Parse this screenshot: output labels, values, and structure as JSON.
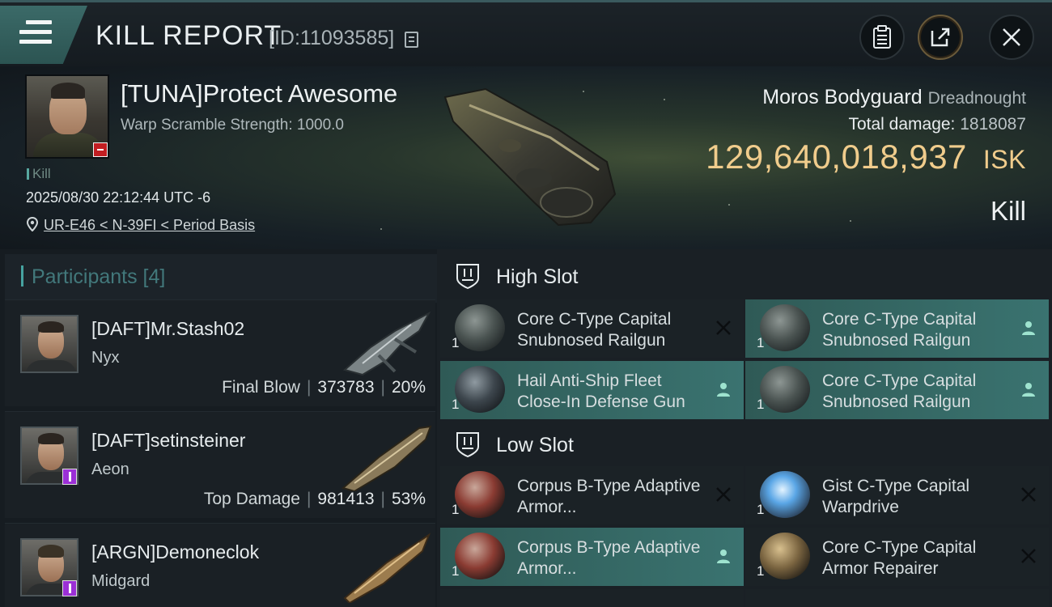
{
  "header": {
    "title": "KILL REPORT",
    "kill_id": "[ID:11093585]"
  },
  "victim": {
    "name": "[TUNA]Protect Awesome",
    "scramble": "Warp Scramble Strength: 1000.0",
    "tag": "Kill",
    "datetime": "2025/08/30 22:12:44 UTC -6",
    "location": "UR-E46 < N-39FI < Period Basis"
  },
  "ship": {
    "name": "Moros Bodyguard",
    "class": "Dreadnought",
    "damage_label": "Total damage:",
    "damage_value": "1818087",
    "isk_value": "129,640,018,937",
    "isk_unit": "ISK",
    "result": "Kill"
  },
  "participants": {
    "label": "Participants [4]",
    "items": [
      {
        "name": "[DAFT]Mr.Stash02",
        "ship": "Nyx",
        "role": "Final Blow",
        "damage": "373783",
        "percent": "20%"
      },
      {
        "name": "[DAFT]setinsteiner",
        "ship": "Aeon",
        "role": "Top Damage",
        "damage": "981413",
        "percent": "53%"
      },
      {
        "name": "[ARGN]Demoneclok",
        "ship": "Midgard",
        "role": "",
        "damage": "",
        "percent": ""
      }
    ]
  },
  "sections": {
    "high": "High Slot",
    "low": "Low Slot"
  },
  "modules": {
    "high": [
      {
        "qty": "1",
        "name": "Core C-Type Capital Snubnosed Railgun",
        "status": "destroyed",
        "icon": "railgun-icon"
      },
      {
        "qty": "1",
        "name": "Core C-Type Capital Snubnosed Railgun",
        "status": "dropped",
        "icon": "railgun-icon"
      },
      {
        "qty": "1",
        "name": "Hail Anti-Ship Fleet Close-In Defense Gun",
        "status": "dropped",
        "icon": "defense-gun-icon"
      },
      {
        "qty": "1",
        "name": "Core C-Type Capital Snubnosed Railgun",
        "status": "dropped",
        "icon": "railgun-icon"
      }
    ],
    "low": [
      {
        "qty": "1",
        "name": "Corpus B-Type Adaptive Armor...",
        "status": "destroyed",
        "icon": "armor-plate-icon"
      },
      {
        "qty": "1",
        "name": "Gist C-Type Capital Warpdrive",
        "status": "destroyed",
        "icon": "warpdrive-icon"
      },
      {
        "qty": "1",
        "name": "Corpus B-Type Adaptive Armor...",
        "status": "dropped",
        "icon": "armor-plate-icon"
      },
      {
        "qty": "1",
        "name": "Core C-Type Capital Armor Repairer",
        "status": "destroyed",
        "icon": "armor-repairer-icon"
      }
    ]
  },
  "colors": {
    "accent": "#46a3a0",
    "isk": "#f0cc8c",
    "dropped_bg": "#3a7370"
  }
}
